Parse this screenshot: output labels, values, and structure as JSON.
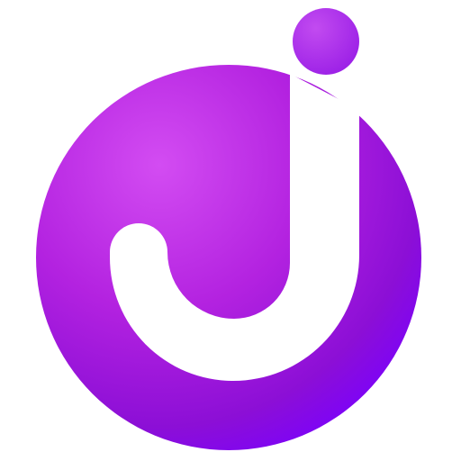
{
  "logo": {
    "icon": "j-letter-logo-icon",
    "colors": {
      "background": "#ffffff",
      "circle_light": "#d34cf2",
      "circle_mid": "#b322e0",
      "circle_dark": "#8c0fd6",
      "circle_edge": "#7a00ff",
      "dot_light": "#c24bf0",
      "dot_dark": "#9a1ee6",
      "letter": "#ffffff"
    }
  }
}
